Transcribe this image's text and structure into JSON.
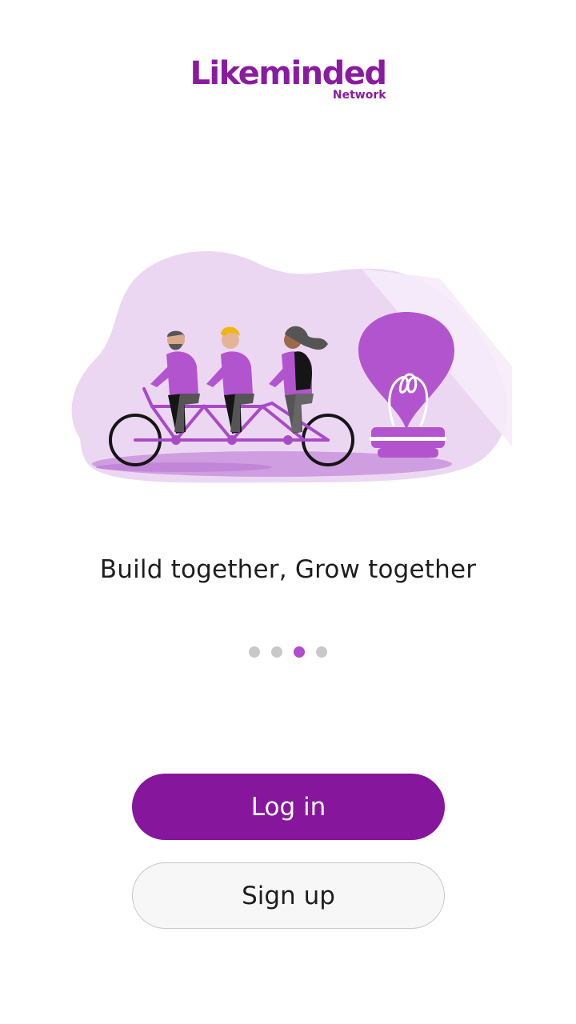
{
  "brand": {
    "name": "Likeminded",
    "sub": "Network",
    "color": "#8a1ba0"
  },
  "onboarding": {
    "tagline": "Build together, Grow together",
    "slide_count": 4,
    "active_slide": 3,
    "illustration_icon": "tandem-bicycle-lightbulb-illustration"
  },
  "actions": {
    "login_label": "Log in",
    "signup_label": "Sign up",
    "accent": "#86169c"
  }
}
